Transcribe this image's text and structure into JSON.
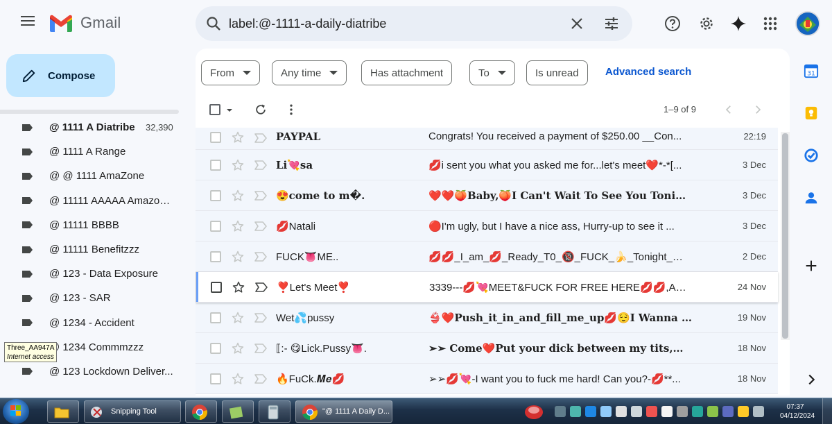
{
  "app": {
    "name": "Gmail"
  },
  "search": {
    "query": "label:@-1111-a-daily-diatribe"
  },
  "compose": {
    "label": "Compose"
  },
  "labels": [
    {
      "name": "@ 1111 A Diatribe",
      "count": "32,390",
      "bold": true
    },
    {
      "name": "@ 1111 A Range"
    },
    {
      "name": "@ @ 1111 AmaZone"
    },
    {
      "name": "@ 11111 AAAAA Amazon ..."
    },
    {
      "name": "@ 11111 BBBB"
    },
    {
      "name": "@ 11111 Benefitzzz"
    },
    {
      "name": "@ 123 - Data Exposure"
    },
    {
      "name": "@ 123 - SAR"
    },
    {
      "name": "@ 1234 - Accident"
    },
    {
      "name": "@ 1234 Commmzzz"
    },
    {
      "name": "@ 123 Lockdown Deliver..."
    }
  ],
  "tooltip": {
    "line1": "Three_AA947A",
    "line2": "Internet access"
  },
  "filters": {
    "from": "From",
    "any_time": "Any time",
    "has_attachment": "Has attachment",
    "to": "To",
    "is_unread": "Is unread",
    "advanced_search": "Advanced search"
  },
  "pager": {
    "range": "1–9 of 9"
  },
  "emails": [
    {
      "sender": "PAYPAL",
      "subject": "Congrats! You received a payment of $250.00 __Con...",
      "date": "22:19",
      "sender_style": "serif",
      "subject_style": "normal"
    },
    {
      "sender": "Li💘sa",
      "subject": "💋i sent you what you asked me for...let's meet❤️*-*[...",
      "date": "3 Dec",
      "sender_style": "serif",
      "subject_style": "normal"
    },
    {
      "sender": "😍come to m�.",
      "subject": "❤️❤️🍑Baby,🍑I Can't Wait To See You Tonight❤️...",
      "date": "3 Dec",
      "sender_style": "serif",
      "subject_style": "serif"
    },
    {
      "sender": "💋Natali",
      "subject": "🔴I'm ugly, but I have a nice ass, Hurry-up to see it ...",
      "date": "3 Dec",
      "sender_style": "normal",
      "subject_style": "normal"
    },
    {
      "sender": "FUCK👅ME..",
      "subject": "💋💋_I_am_💋_Ready_T0_🔞_FUCK_🍌_Tonight_👅_...",
      "date": "2 Dec",
      "sender_style": "normal",
      "subject_style": "normal"
    },
    {
      "sender": "❣️Let's Meet❣️",
      "subject": "3339---💋💘MEET&FUCK FOR FREE HERE💋💋,ARE Y...",
      "date": "24 Nov",
      "sender_style": "normal",
      "subject_style": "normal",
      "hover": true
    },
    {
      "sender": "Wet💦pussy",
      "subject": "👙❤️Push_it_in_and_fill_me_up💋😌I Wanna Suc...",
      "date": "19 Nov",
      "sender_style": "normal",
      "subject_style": "serif"
    },
    {
      "sender": "⟦:- 😋Lick.Pussy👅.",
      "subject": "➢➢ Come❤️Put your dick between my tits,💋I w...",
      "date": "18 Nov",
      "sender_style": "normal",
      "subject_style": "serif"
    },
    {
      "sender": "🔥FuCk.𝑴𝒆💋",
      "subject": "➢➢💋💘-I want you to fuck me hard! Can you?-💋**...",
      "date": "18 Nov",
      "sender_style": "normal",
      "subject_style": "normal"
    }
  ],
  "taskbar": {
    "snipping_tool": "Snipping Tool",
    "chrome_window": "\"@ 1111 A Daily D...",
    "time": "07:37",
    "date": "04/12/2024"
  },
  "colors": {
    "accent": "#0b57d0",
    "compose_bg": "#c2e7ff",
    "search_bg": "#e9eef6"
  }
}
